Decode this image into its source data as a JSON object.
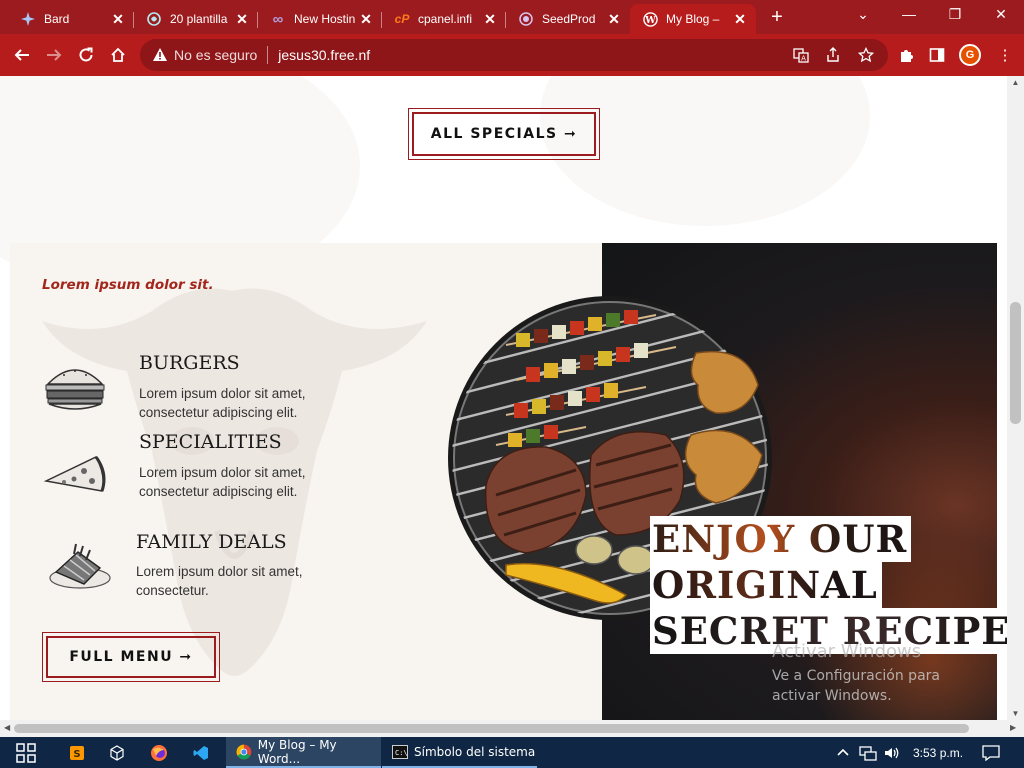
{
  "browser": {
    "tabs": [
      {
        "title": "Bard",
        "icon": "bard-icon",
        "active": false
      },
      {
        "title": "20 plantilla",
        "icon": "wp-template-icon",
        "active": false
      },
      {
        "title": "New Hostin",
        "icon": "infinity-icon",
        "active": false
      },
      {
        "title": "cpanel.infi",
        "icon": "cpanel-icon",
        "active": false
      },
      {
        "title": "SeedProd",
        "icon": "seedprod-icon",
        "active": false
      },
      {
        "title": "My Blog –",
        "icon": "wordpress-icon",
        "active": true
      }
    ],
    "omnibox": {
      "security_label": "No es seguro",
      "url": "jesus30.free.nf"
    },
    "profile_initial": "G",
    "accent": "#b71c1c"
  },
  "page": {
    "all_specials_label": "ALL SPECIALS ➞",
    "eyebrow": "Lorem ipsum dolor sit.",
    "menu_items": [
      {
        "title": "BURGERS",
        "desc": "Lorem ipsum dolor sit amet, consectetur adipiscing elit.",
        "icon": "burger-icon"
      },
      {
        "title": "SPECIALITIES",
        "desc": "Lorem ipsum dolor sit amet, consectetur adipiscing elit.",
        "icon": "pizza-slice-icon"
      },
      {
        "title": "FAMILY DEALS",
        "desc": "Lorem ipsum dolor sit amet, consectetur.",
        "icon": "ribs-icon"
      }
    ],
    "full_menu_label": "FULL MENU ➞",
    "headline": [
      "ENJOY OUR",
      "ORIGINAL",
      "SECRET RECIPE"
    ],
    "brand_color": "#9c1b1f"
  },
  "watermark": {
    "title": "Activar Windows",
    "subtitle": "Ve a Configuración para activar Windows."
  },
  "taskbar": {
    "tasks": [
      {
        "label": "My Blog – My Word...",
        "icon": "chrome-icon",
        "active": true
      },
      {
        "label": "Símbolo del sistema",
        "icon": "cmd-icon",
        "active": false
      }
    ],
    "time": "3:53 p.m."
  }
}
